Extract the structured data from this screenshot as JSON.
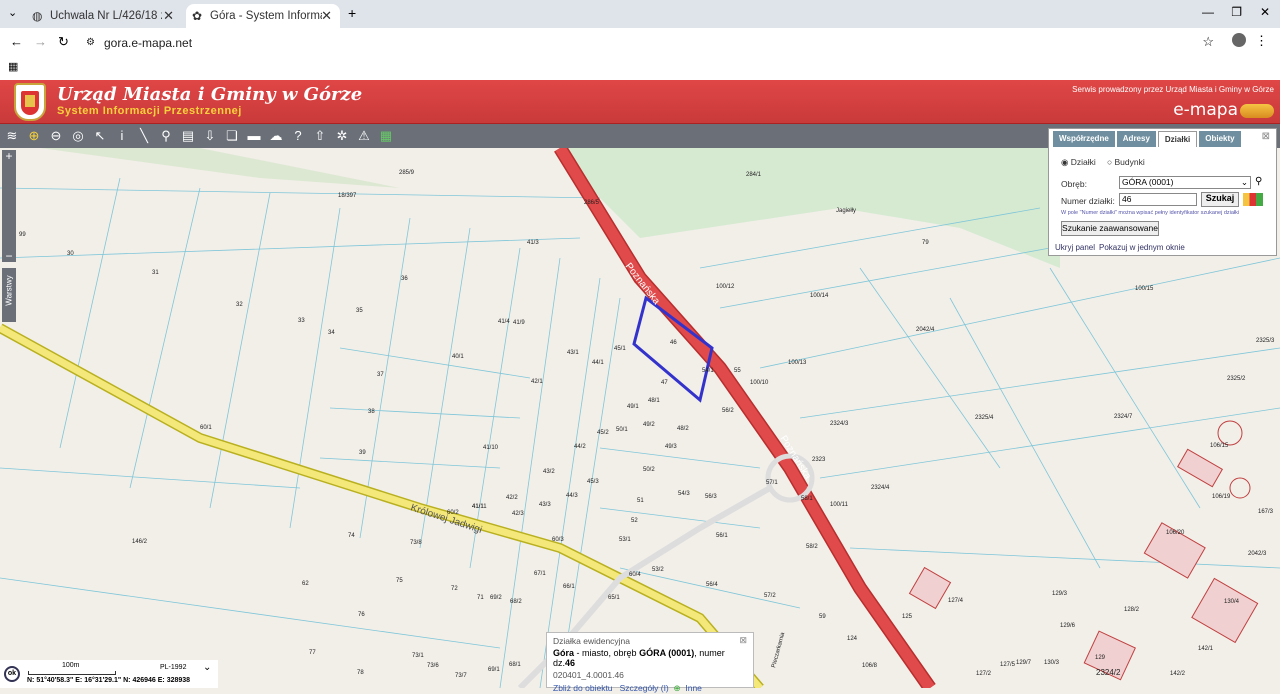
{
  "browser": {
    "tabs": [
      {
        "title": "Uchwala Nr L/426/18 z dnia 21"
      },
      {
        "title": "Góra - System Informacji Przest"
      }
    ],
    "url": "gora.e-mapa.net"
  },
  "header": {
    "title": "Urząd Miasta i Gminy w Górze",
    "subtitle": "System Informacji Przestrzennej",
    "service_text": "Serwis prowadzony przez Urząd Miasta i Gminy w Górze",
    "brand": "e-mapa"
  },
  "panel": {
    "tabs": [
      "Współrzędne",
      "Adresy",
      "Działki",
      "Obiekty"
    ],
    "active_tab": "Działki",
    "radio_dzialki": "Działki",
    "radio_budynki": "Budynki",
    "obreb_label": "Obręb:",
    "obreb_value": "GÓRA (0001)",
    "numer_label": "Numer działki:",
    "numer_value": "46",
    "search_button": "Szukaj",
    "hint": "W pole \"Numer działki\" można wpisać pełny identyfikator szukanej działki",
    "advanced_button": "Szukanie zaawansowane",
    "hide_panel": "Ukryj panel",
    "single_window": "Pokazuj w jednym oknie"
  },
  "sidebar": {
    "layers_label": "Warstwy"
  },
  "popup": {
    "heading": "Działka ewidencyjna",
    "line1_a": "Góra",
    "line1_b": " - miasto",
    "line1_c": ", obręb ",
    "line1_d": "GÓRA (0001)",
    "line1_e": ", numer dz.",
    "line1_f": "46",
    "id": "020401_4.0001.46",
    "zoom_link": "Zbliż do obiektu",
    "details_link": "Szczegóły (I)",
    "other_link": "Inne"
  },
  "scalebar": {
    "ok": "ok",
    "distance": "100m",
    "crs": "PL-1992",
    "coords": "N: 51°40'58.3\" E: 16°31'29.1\" N: 426946 E: 328938"
  },
  "map": {
    "streets": [
      "Poznańska",
      "Królowej Jadwigi",
      "Poznańska"
    ],
    "parcels": [
      "285/9",
      "284/1",
      "286/5",
      "18/397",
      "30",
      "31",
      "32",
      "33",
      "34",
      "35",
      "36",
      "37",
      "38",
      "39",
      "40/1",
      "41/1",
      "41/3",
      "41/4",
      "41/9",
      "41/10",
      "41/11",
      "42/1",
      "42/2",
      "42/3",
      "43/1",
      "43/2",
      "43/3",
      "44/1",
      "44/2",
      "44/3",
      "45/1",
      "45/2",
      "45/3",
      "46",
      "47",
      "48/1",
      "48/2",
      "49/1",
      "49/2",
      "49/3",
      "50/1",
      "50/2",
      "51",
      "52",
      "53/1",
      "53/2",
      "54/1",
      "54/3",
      "55",
      "56/1",
      "56/2",
      "56/3",
      "56/4",
      "57/1",
      "57/2",
      "58/1",
      "58/2",
      "59",
      "60/1",
      "60/2",
      "60/3",
      "60/4",
      "62",
      "65/1",
      "66/1",
      "67/1",
      "68/1",
      "68/2",
      "69/1",
      "69/2",
      "71",
      "72",
      "73/1",
      "73/6",
      "73/7",
      "73/8",
      "74",
      "75",
      "76",
      "77",
      "78",
      "79",
      "100/10",
      "100/11",
      "100/12",
      "100/13",
      "100/14",
      "100/15",
      "106/15",
      "106/19",
      "106/20",
      "106/8",
      "124",
      "125",
      "127/2",
      "127/4",
      "127/5",
      "128/2",
      "129",
      "129/3",
      "129/6",
      "129/7",
      "130/3",
      "130/4",
      "142/1",
      "142/2",
      "146/2",
      "167/3",
      "2042/3",
      "2042/4",
      "2323",
      "2324/3",
      "2324/4",
      "2324/7",
      "2325/2",
      "2325/3",
      "2325/4",
      "2324/2",
      "Pieczarkarnia",
      "Jagiełły",
      "99",
      "29",
      "43/1"
    ]
  },
  "colors": {
    "header": "#d94040",
    "road": "#e04a4a",
    "parcel_highlight": "#3333cc",
    "map_bg": "#f2efe9",
    "parcel_line": "#7fc6d8"
  }
}
